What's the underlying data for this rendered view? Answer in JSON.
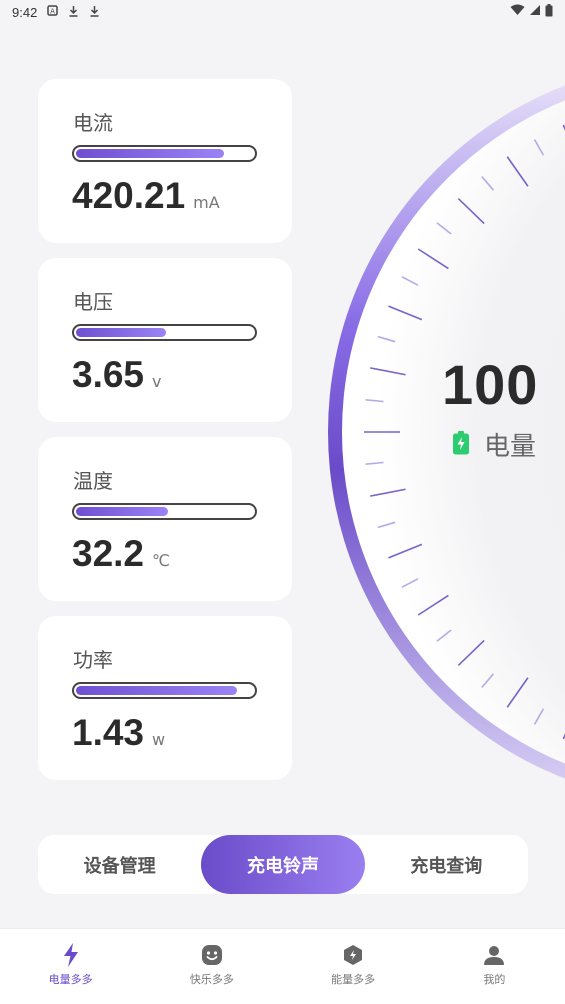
{
  "status_bar": {
    "time": "9:42"
  },
  "metrics": [
    {
      "label": "电流",
      "value": "420.21",
      "unit": "mA",
      "fill_fraction": 0.84
    },
    {
      "label": "电压",
      "value": "3.65",
      "unit": "v",
      "fill_fraction": 0.52
    },
    {
      "label": "温度",
      "value": "32.2",
      "unit": "℃",
      "fill_fraction": 0.53
    },
    {
      "label": "功率",
      "value": "1.43",
      "unit": "w",
      "fill_fraction": 0.91
    }
  ],
  "gauge": {
    "value": "100",
    "label": "电量",
    "battery_icon": "battery-charging-icon"
  },
  "segmented": [
    {
      "label": "设备管理",
      "active": false
    },
    {
      "label": "充电铃声",
      "active": true
    },
    {
      "label": "充电查询",
      "active": false
    }
  ],
  "bottom_nav": [
    {
      "label": "电量多多",
      "icon": "lightning-icon",
      "active": true
    },
    {
      "label": "快乐多多",
      "icon": "smile-icon",
      "active": false
    },
    {
      "label": "能量多多",
      "icon": "energy-hex-icon",
      "active": false
    },
    {
      "label": "我的",
      "icon": "person-icon",
      "active": false
    }
  ],
  "colors": {
    "accent": "#6a4bc9",
    "accent_light": "#9a7ff0",
    "battery": "#2ecc71"
  }
}
